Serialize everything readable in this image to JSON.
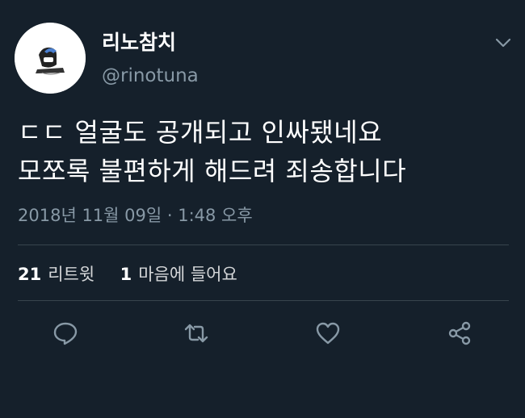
{
  "profile": {
    "display_name": "리노참치",
    "handle": "@rinotuna",
    "avatar_icon": "avatar-image",
    "menu_icon": "chevron-down-icon"
  },
  "tweet": {
    "line1": "ㄷㄷ 얼굴도 공개되고 인싸됐네요",
    "line2": "모쪼록 불편하게 해드려 죄송합니다",
    "timestamp": "2018년 11월 09일 · 1:48 오후"
  },
  "stats": {
    "retweets_count": "21",
    "retweets_label": "리트윗",
    "likes_count": "1",
    "likes_label": "마음에 들어요"
  },
  "actions": [
    {
      "icon": "reply-icon"
    },
    {
      "icon": "retweet-icon"
    },
    {
      "icon": "like-heart-icon"
    },
    {
      "icon": "share-icon"
    }
  ],
  "colors": {
    "background": "#15202b",
    "secondary_text": "#8899a6",
    "divider": "#38444d",
    "text": "#ffffff"
  }
}
